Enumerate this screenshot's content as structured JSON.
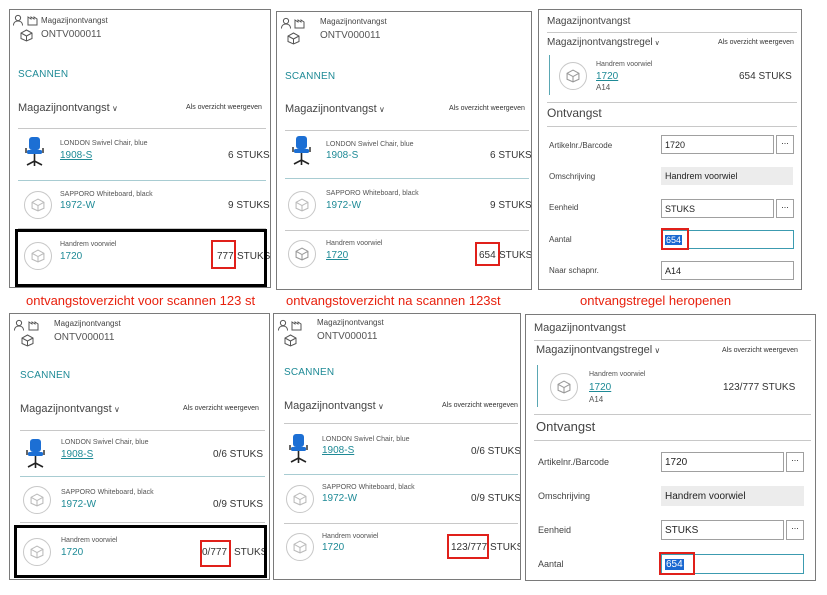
{
  "header": {
    "title": "Magazijnontvangst",
    "doc_no": "ONTV000011"
  },
  "scan_label": "SCANNEN",
  "section": {
    "title": "Magazijnontvangst",
    "overview_link": "Als overzicht weergeven"
  },
  "items": [
    {
      "name": "LONDON Swivel Chair, blue",
      "code": "1908-S",
      "icon": "chair-image"
    },
    {
      "name": "SAPPORO Whiteboard, black",
      "code": "1972-W",
      "icon": "box-icon"
    },
    {
      "name": "Handrem voorwiel",
      "code": "1720",
      "icon": "box-icon"
    }
  ],
  "qty_top_before": [
    "6 STUKS",
    "9 STUKS",
    "777",
    "STUKS"
  ],
  "qty_top_after": [
    "6 STUKS",
    "9 STUKS",
    "654",
    "STUKS"
  ],
  "qty_bottom_before": [
    "0/6 STUKS",
    "0/9 STUKS",
    "0/777",
    "STUKS"
  ],
  "qty_bottom_after": [
    "0/6 STUKS",
    "0/9 STUKS",
    "123/777",
    "STUKS"
  ],
  "captions": {
    "c1": "ontvangstoverzicht voor scannen 123 st",
    "c2": "ontvangstoverzicht na scannen 123st",
    "c3": "ontvangstregel heropenen"
  },
  "detail": {
    "title": "Magazijnontvangst",
    "line_section": "Magazijnontvangstregel",
    "overview_link": "Als overzicht weergeven",
    "item_name": "Handrem voorwiel",
    "item_code": "1720",
    "item_bin": "A14",
    "qty_top": "654 STUKS",
    "qty_bottom": "123/777 STUKS",
    "receipt_section": "Ontvangst",
    "fields": {
      "barcode_label": "Artikelnr./Barcode",
      "barcode_value": "1720",
      "desc_label": "Omschrijving",
      "desc_value": "Handrem voorwiel",
      "unit_label": "Eenheid",
      "unit_value": "STUKS",
      "qty_label": "Aantal",
      "qty_value": "654",
      "bin_label": "Naar schapnr.",
      "bin_value": "A14"
    },
    "lookup": "..."
  }
}
